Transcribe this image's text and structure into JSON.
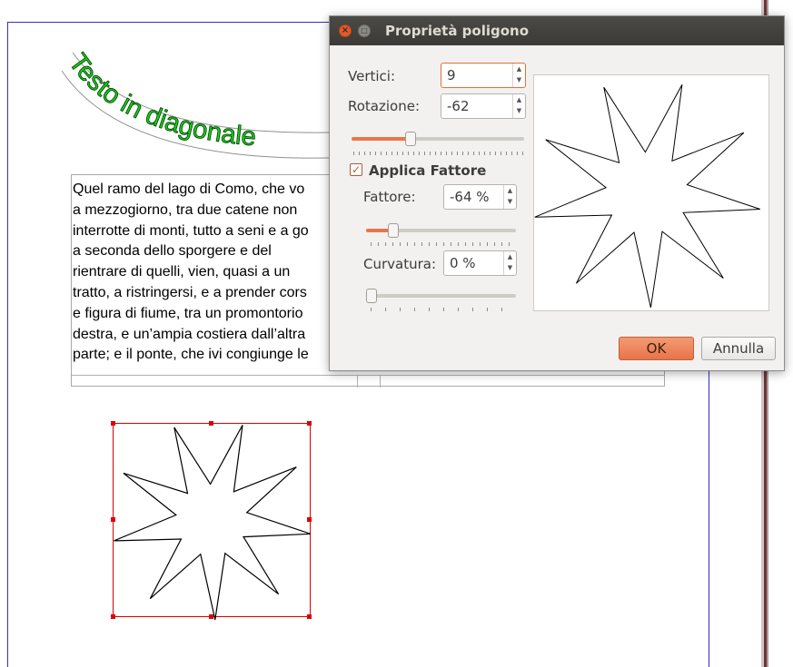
{
  "document": {
    "curved_text": "Testo in diagonale",
    "body_text": "Quel ramo del lago di Como, che vo\na mezzogiorno, tra due catene non\ninterrotte di monti, tutto a seni e a go\na seconda dello sporgere e del\nrientrare di quelli, vien, quasi a un\ntratto, a ristringersi, e a prender cors\ne figura di fiume, tra un promontorio\ndestra, e un’ampia costiera dall’altra\nparte; e il ponte, che ivi congiunge le",
    "star_points": 9,
    "star_rotation": -62,
    "star_factor": -64
  },
  "dialog": {
    "title": "Proprietà poligono",
    "close_glyph": "×",
    "max_glyph": "□",
    "vertices": {
      "label": "Vertici:",
      "value": "9"
    },
    "rotation": {
      "label": "Rotazione:",
      "value": "-62",
      "slider_fraction": 0.34
    },
    "apply_factor": {
      "label": "Applica Fattore",
      "checked": true
    },
    "factor": {
      "label": "Fattore:",
      "value": "-64 %",
      "slider_fraction": 0.18
    },
    "curvature": {
      "label": "Curvatura:",
      "value": "0 %",
      "slider_fraction": 0.0
    },
    "ok_label": "OK",
    "cancel_label": "Annulla"
  },
  "colors": {
    "accent": "#e9764a",
    "titlebar": "#3f3e3a",
    "curved_text_fill": "#19d019",
    "selection": "#e00000"
  }
}
